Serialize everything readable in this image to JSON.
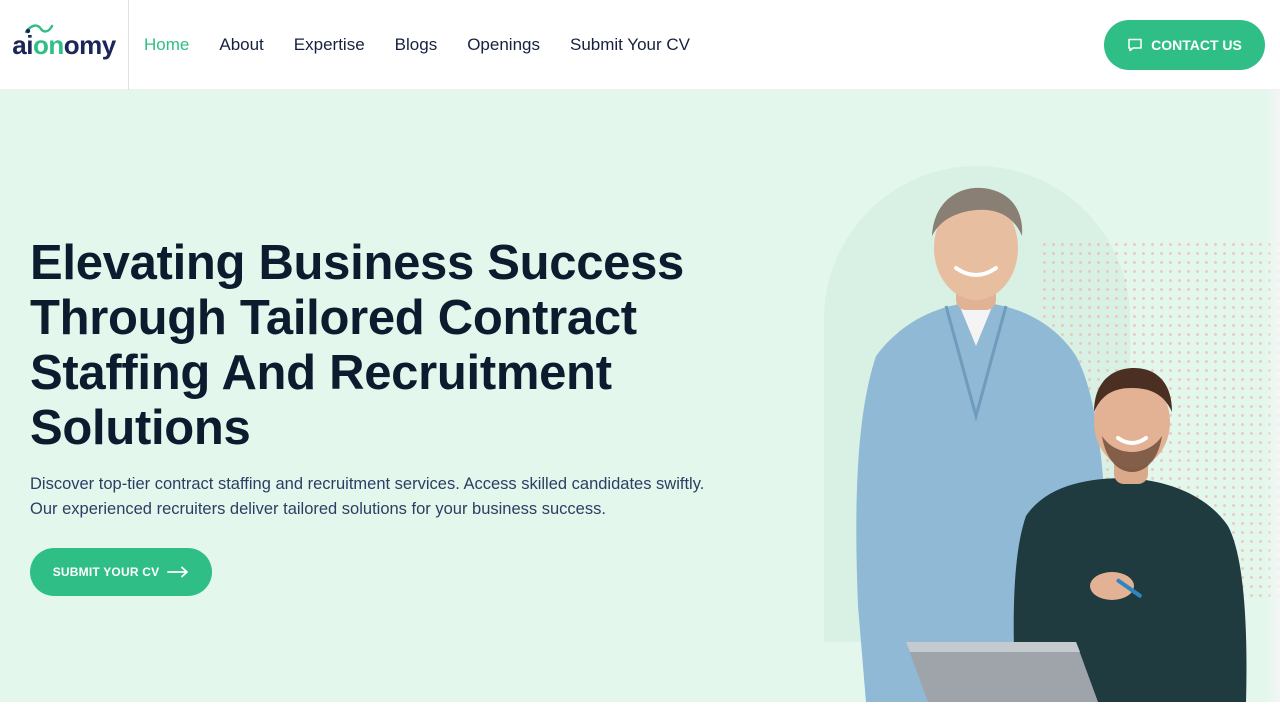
{
  "brand": {
    "logo_prefix": "ai",
    "logo_highlight": "on",
    "logo_suffix": "omy"
  },
  "nav": {
    "items": [
      {
        "label": "Home"
      },
      {
        "label": "About"
      },
      {
        "label": "Expertise"
      },
      {
        "label": "Blogs"
      },
      {
        "label": "Openings"
      },
      {
        "label": "Submit Your CV"
      }
    ],
    "active_index": 0
  },
  "header": {
    "contact_label": "CONTACT US",
    "contact_icon": "message-icon"
  },
  "hero": {
    "headline_lines": [
      "Elevating Business Success",
      "Through Tailored Contract",
      "Staffing And Recruitment",
      "Solutions"
    ],
    "subtext": "Discover top-tier contract staffing and recruitment services. Access skilled candidates swiftly. Our experienced recruiters deliver tailored solutions for your business success.",
    "cta_label": "SUBMIT YOUR CV",
    "cta_icon": "arrow-right-icon",
    "image_icon": "business-people-photo"
  },
  "colors": {
    "accent": "#2fbf86",
    "navy": "#15213f",
    "hero_bg": "#e3f7ec",
    "heading": "#0d1b2e",
    "body_text": "#2c3e63"
  }
}
